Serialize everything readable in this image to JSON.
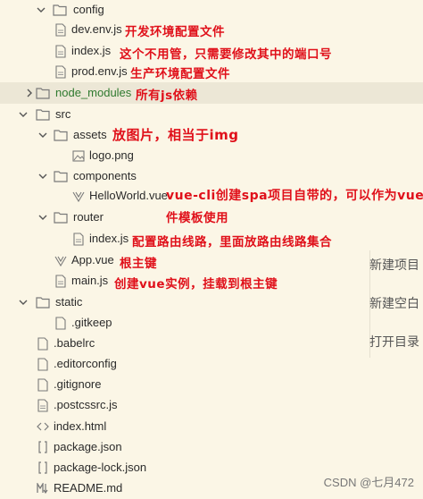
{
  "tree": {
    "config": "config",
    "dev_env": "dev.env.js",
    "index_js_config": "index.js",
    "prod_env": "prod.env.js",
    "node_modules": "node_modules",
    "src": "src",
    "assets": "assets",
    "logo": "logo.png",
    "components": "components",
    "helloworld": "HelloWorld.vue",
    "router": "router",
    "index_js_router": "index.js",
    "app_vue": "App.vue",
    "main_js": "main.js",
    "static": "static",
    "gitkeep": ".gitkeep",
    "babelrc": ".babelrc",
    "editorconfig": ".editorconfig",
    "gitignore": ".gitignore",
    "postcssrc": ".postcssrc.js",
    "index_html": "index.html",
    "package_json": "package.json",
    "package_lock": "package-lock.json",
    "readme": "README.md"
  },
  "notes": {
    "dev_env": "开发环境配置文件",
    "index_js_config": "这个不用管，只需要修改其中的端口号",
    "prod_env": "生产环境配置文件",
    "node_modules": "所有js依赖",
    "assets": "放图片，相当于img",
    "helloworld_line1": "vue-cli创建spa项目自带的，可以作为vue文",
    "helloworld_line2": "件模板使用",
    "index_js_router": "配置路由线路，里面放路由线路集合",
    "app_vue": "根主键",
    "main_js": "创建vue实例，挂载到根主键"
  },
  "context_menu": {
    "new_project": "新建项目",
    "new_blank": "新建空白",
    "open_dir": "打开目录"
  },
  "watermark": "CSDN @七月472",
  "colors": {
    "note": "#e0101a",
    "background": "#fbf6e6",
    "highlight": "#ece7d6",
    "folder": "#7a7a7a"
  }
}
